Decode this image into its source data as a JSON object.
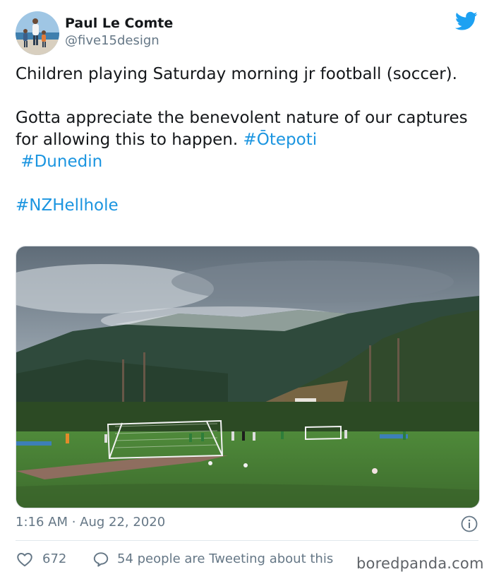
{
  "tweet": {
    "author_name": "Paul Le Comte",
    "author_handle": "@five15design",
    "text_line1": "Children playing Saturday morning jr football (soccer).",
    "text_line2": "Gotta appreciate the benevolent nature of our captures for allowing this to happen.",
    "hashtags_inline": [
      "#Ōtepoti",
      "#Dunedin"
    ],
    "hashtag_last": "#NZHellhole",
    "timestamp": "1:16 AM · Aug 22, 2020",
    "like_count": "672",
    "tweeting_text": "54 people are Tweeting about this"
  },
  "watermark": "boredpanda.com",
  "colors": {
    "hashtag": "#1b95e0",
    "twitter_brand": "#1da1f2",
    "secondary_text": "#657786"
  },
  "icons": [
    "twitter-bird-icon",
    "info-icon",
    "heart-icon",
    "reply-bubble-icon"
  ]
}
